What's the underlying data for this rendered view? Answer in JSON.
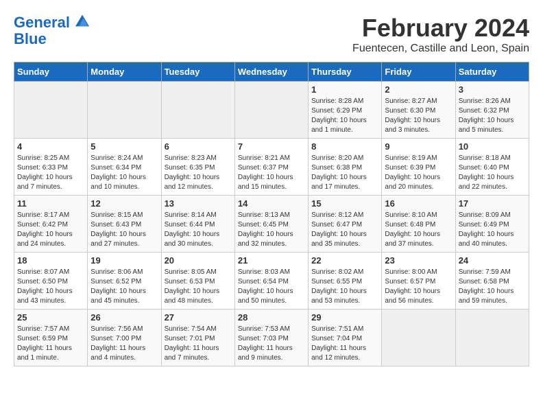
{
  "header": {
    "logo_line1": "General",
    "logo_line2": "Blue",
    "month": "February 2024",
    "location": "Fuentecen, Castille and Leon, Spain"
  },
  "days_of_week": [
    "Sunday",
    "Monday",
    "Tuesday",
    "Wednesday",
    "Thursday",
    "Friday",
    "Saturday"
  ],
  "weeks": [
    [
      {
        "day": "",
        "info": ""
      },
      {
        "day": "",
        "info": ""
      },
      {
        "day": "",
        "info": ""
      },
      {
        "day": "",
        "info": ""
      },
      {
        "day": "1",
        "info": "Sunrise: 8:28 AM\nSunset: 6:29 PM\nDaylight: 10 hours and 1 minute."
      },
      {
        "day": "2",
        "info": "Sunrise: 8:27 AM\nSunset: 6:30 PM\nDaylight: 10 hours and 3 minutes."
      },
      {
        "day": "3",
        "info": "Sunrise: 8:26 AM\nSunset: 6:32 PM\nDaylight: 10 hours and 5 minutes."
      }
    ],
    [
      {
        "day": "4",
        "info": "Sunrise: 8:25 AM\nSunset: 6:33 PM\nDaylight: 10 hours and 7 minutes."
      },
      {
        "day": "5",
        "info": "Sunrise: 8:24 AM\nSunset: 6:34 PM\nDaylight: 10 hours and 10 minutes."
      },
      {
        "day": "6",
        "info": "Sunrise: 8:23 AM\nSunset: 6:35 PM\nDaylight: 10 hours and 12 minutes."
      },
      {
        "day": "7",
        "info": "Sunrise: 8:21 AM\nSunset: 6:37 PM\nDaylight: 10 hours and 15 minutes."
      },
      {
        "day": "8",
        "info": "Sunrise: 8:20 AM\nSunset: 6:38 PM\nDaylight: 10 hours and 17 minutes."
      },
      {
        "day": "9",
        "info": "Sunrise: 8:19 AM\nSunset: 6:39 PM\nDaylight: 10 hours and 20 minutes."
      },
      {
        "day": "10",
        "info": "Sunrise: 8:18 AM\nSunset: 6:40 PM\nDaylight: 10 hours and 22 minutes."
      }
    ],
    [
      {
        "day": "11",
        "info": "Sunrise: 8:17 AM\nSunset: 6:42 PM\nDaylight: 10 hours and 24 minutes."
      },
      {
        "day": "12",
        "info": "Sunrise: 8:15 AM\nSunset: 6:43 PM\nDaylight: 10 hours and 27 minutes."
      },
      {
        "day": "13",
        "info": "Sunrise: 8:14 AM\nSunset: 6:44 PM\nDaylight: 10 hours and 30 minutes."
      },
      {
        "day": "14",
        "info": "Sunrise: 8:13 AM\nSunset: 6:45 PM\nDaylight: 10 hours and 32 minutes."
      },
      {
        "day": "15",
        "info": "Sunrise: 8:12 AM\nSunset: 6:47 PM\nDaylight: 10 hours and 35 minutes."
      },
      {
        "day": "16",
        "info": "Sunrise: 8:10 AM\nSunset: 6:48 PM\nDaylight: 10 hours and 37 minutes."
      },
      {
        "day": "17",
        "info": "Sunrise: 8:09 AM\nSunset: 6:49 PM\nDaylight: 10 hours and 40 minutes."
      }
    ],
    [
      {
        "day": "18",
        "info": "Sunrise: 8:07 AM\nSunset: 6:50 PM\nDaylight: 10 hours and 43 minutes."
      },
      {
        "day": "19",
        "info": "Sunrise: 8:06 AM\nSunset: 6:52 PM\nDaylight: 10 hours and 45 minutes."
      },
      {
        "day": "20",
        "info": "Sunrise: 8:05 AM\nSunset: 6:53 PM\nDaylight: 10 hours and 48 minutes."
      },
      {
        "day": "21",
        "info": "Sunrise: 8:03 AM\nSunset: 6:54 PM\nDaylight: 10 hours and 50 minutes."
      },
      {
        "day": "22",
        "info": "Sunrise: 8:02 AM\nSunset: 6:55 PM\nDaylight: 10 hours and 53 minutes."
      },
      {
        "day": "23",
        "info": "Sunrise: 8:00 AM\nSunset: 6:57 PM\nDaylight: 10 hours and 56 minutes."
      },
      {
        "day": "24",
        "info": "Sunrise: 7:59 AM\nSunset: 6:58 PM\nDaylight: 10 hours and 59 minutes."
      }
    ],
    [
      {
        "day": "25",
        "info": "Sunrise: 7:57 AM\nSunset: 6:59 PM\nDaylight: 11 hours and 1 minute."
      },
      {
        "day": "26",
        "info": "Sunrise: 7:56 AM\nSunset: 7:00 PM\nDaylight: 11 hours and 4 minutes."
      },
      {
        "day": "27",
        "info": "Sunrise: 7:54 AM\nSunset: 7:01 PM\nDaylight: 11 hours and 7 minutes."
      },
      {
        "day": "28",
        "info": "Sunrise: 7:53 AM\nSunset: 7:03 PM\nDaylight: 11 hours and 9 minutes."
      },
      {
        "day": "29",
        "info": "Sunrise: 7:51 AM\nSunset: 7:04 PM\nDaylight: 11 hours and 12 minutes."
      },
      {
        "day": "",
        "info": ""
      },
      {
        "day": "",
        "info": ""
      }
    ]
  ]
}
